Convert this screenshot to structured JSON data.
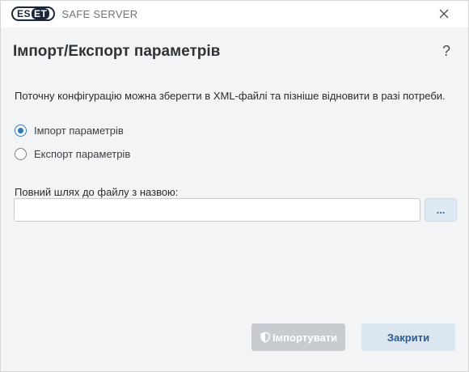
{
  "titlebar": {
    "logo_text_part1": "ES",
    "logo_text_part2": "ET",
    "product": "SAFE SERVER"
  },
  "dialog": {
    "title": "Імпорт/Експорт параметрів",
    "help_symbol": "?",
    "description": "Поточну конфігурацію можна зберегти в XML-файлі та пізніше відновити в разі потреби.",
    "options": [
      {
        "label": "Імпорт параметрів",
        "selected": true
      },
      {
        "label": "Експорт параметрів",
        "selected": false
      }
    ],
    "path_label": "Повний шлях до файлу з назвою:",
    "path_value": "",
    "browse_label": "...",
    "import_button": "Імпортувати",
    "close_button": "Закрити"
  },
  "colors": {
    "accent": "#2f7ab8",
    "disabled_button": "#c8cbcf",
    "secondary_button": "#dbe6f1"
  }
}
